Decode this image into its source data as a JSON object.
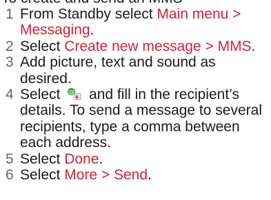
{
  "header": {
    "cutoff_text": "To create and send an MMS"
  },
  "steps": [
    {
      "num": "1",
      "pre": "From Standby select ",
      "link": "Main menu > Messaging",
      "post": "."
    },
    {
      "num": "2",
      "pre": "Select ",
      "link": "Create new message > MMS",
      "post": "."
    },
    {
      "num": "3",
      "text": "Add picture, text and sound as desired."
    },
    {
      "num": "4",
      "pre": "Select ",
      "post": " and fill in the recipient’s details. To send a message to several recipients, type a comma between each address.",
      "icon": "send-message-icon"
    },
    {
      "num": "5",
      "pre": "Select ",
      "link": "Done",
      "post": "."
    },
    {
      "num": "6",
      "pre": "Select ",
      "link": "More > Send",
      "post": "."
    }
  ],
  "colors": {
    "link": "#d5232f",
    "number": "#666666",
    "text": "#1a1a1a",
    "icon_green": "#3aa63c"
  }
}
